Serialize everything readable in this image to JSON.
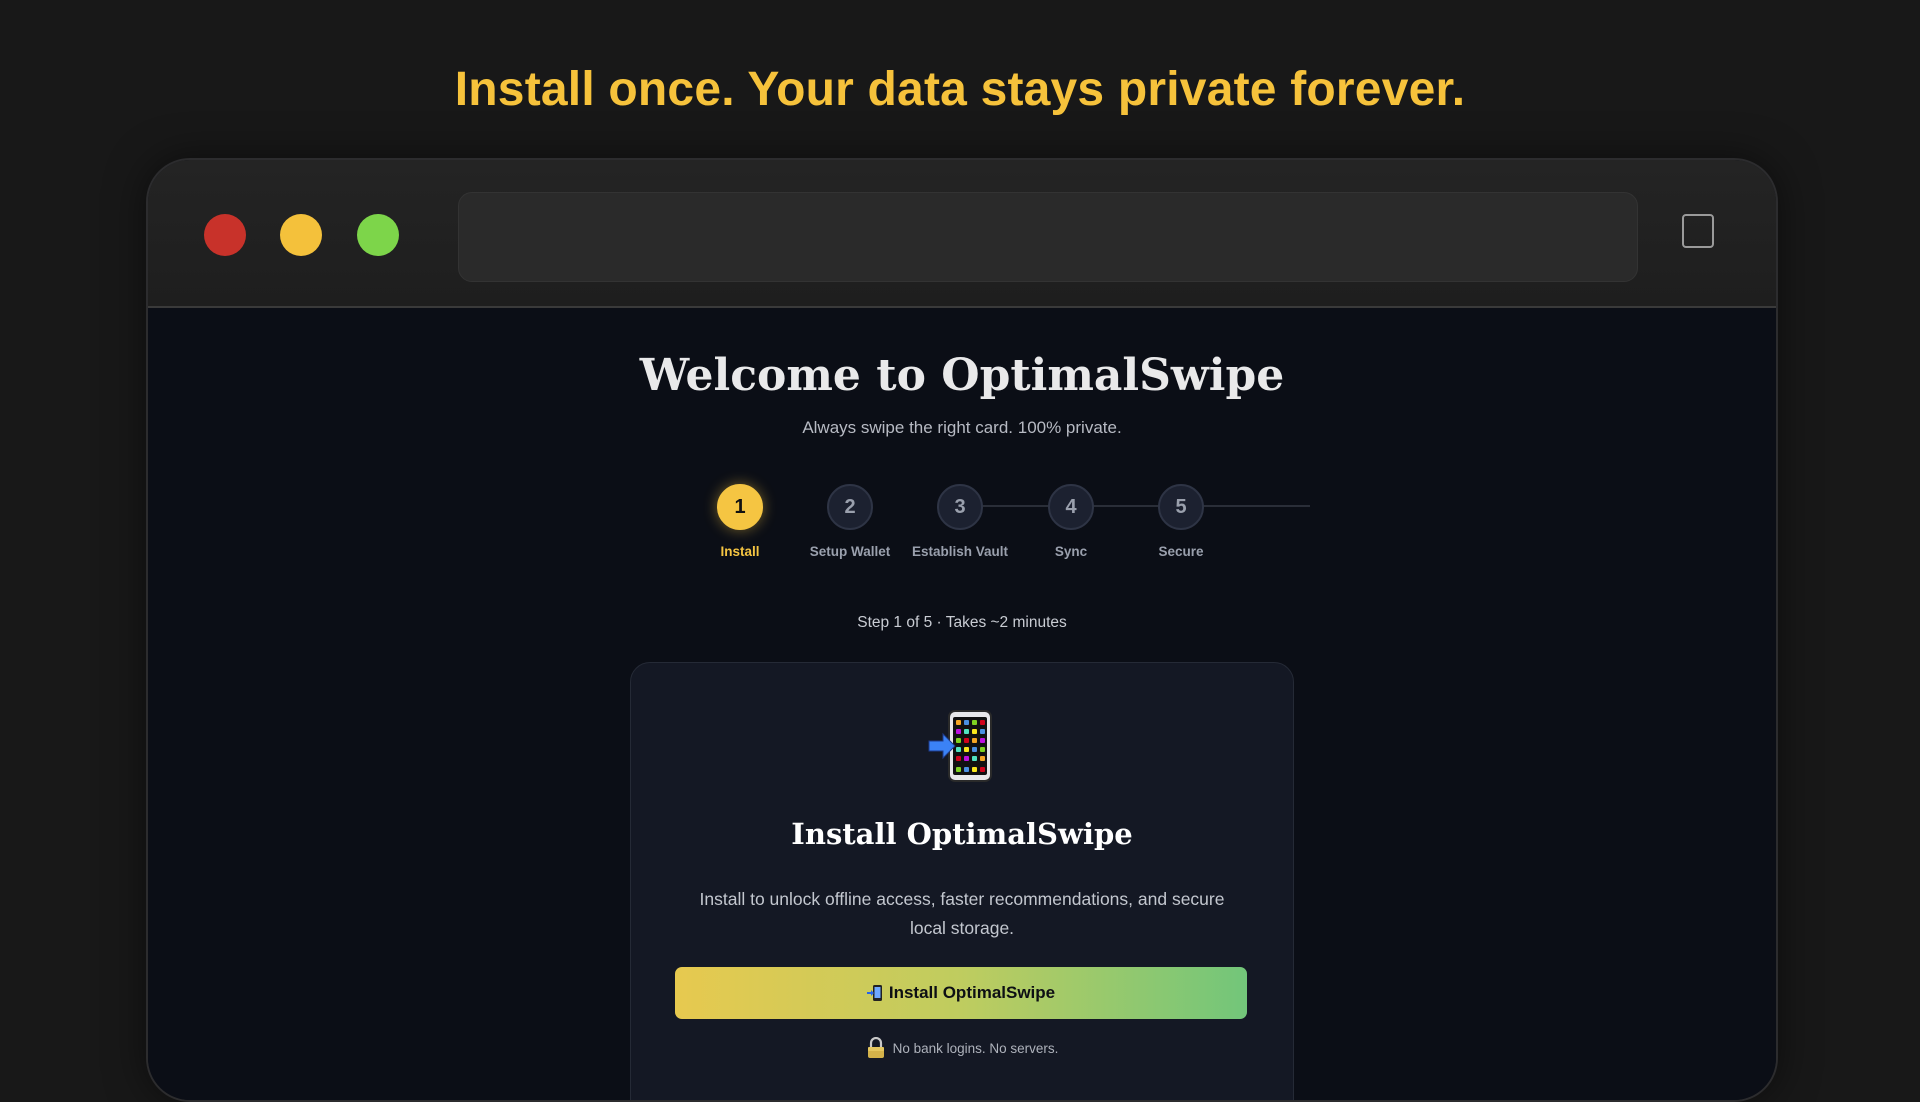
{
  "headline": "Install once. Your data stays private forever.",
  "page": {
    "title": "Welcome to OptimalSwipe",
    "subtitle": "Always swipe the right card. 100% private."
  },
  "steps": [
    {
      "number": "1",
      "label": "Install",
      "active": true
    },
    {
      "number": "2",
      "label": "Setup Wallet",
      "active": false
    },
    {
      "number": "3",
      "label": "Establish Vault",
      "active": false
    },
    {
      "number": "4",
      "label": "Sync",
      "active": false
    },
    {
      "number": "5",
      "label": "Secure",
      "active": false
    }
  ],
  "progress_text": "Step 1 of 5 · Takes ~2 minutes",
  "card": {
    "icon": "phone-arrow-icon",
    "title": "Install OptimalSwipe",
    "description": "Install to unlock offline access, faster recommendations, and secure local storage.",
    "button_label": "Install OptimalSwipe",
    "privacy_note": "No bank logins. No servers."
  },
  "colors": {
    "accent": "#f5c542",
    "background": "#0b0e16",
    "card": "#141824"
  }
}
